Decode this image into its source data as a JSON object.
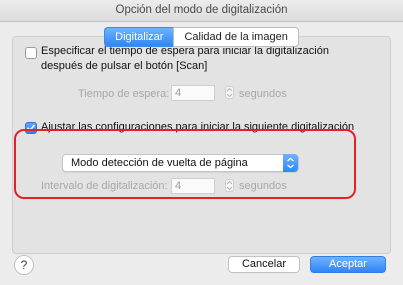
{
  "window": {
    "title": "Opción del modo de digitalización"
  },
  "tabs": [
    {
      "label": "Digitalizar",
      "active": true
    },
    {
      "label": "Calidad de la imagen",
      "active": false
    }
  ],
  "wait_option": {
    "checked": false,
    "label_line1": "Especificar el tiempo de espera para iniciar la digitalización",
    "label_line2": "después de pulsar el botón [Scan]",
    "field_label": "Tiempo de espera:",
    "field_value": "4",
    "unit": "segundos"
  },
  "adjust_option": {
    "checked": true,
    "label": "Ajustar las configuraciones para iniciar la siguiente digitalización"
  },
  "mode_select": {
    "value": "Modo detección de vuelta de página"
  },
  "interval": {
    "field_label": "Intervalo de digitalización:",
    "field_value": "4",
    "unit": "segundos"
  },
  "footer": {
    "help": "?",
    "cancel_label": "Cancelar",
    "accept_label": "Aceptar"
  },
  "colors": {
    "accent": "#2f86f6",
    "highlight": "#e5202a"
  }
}
